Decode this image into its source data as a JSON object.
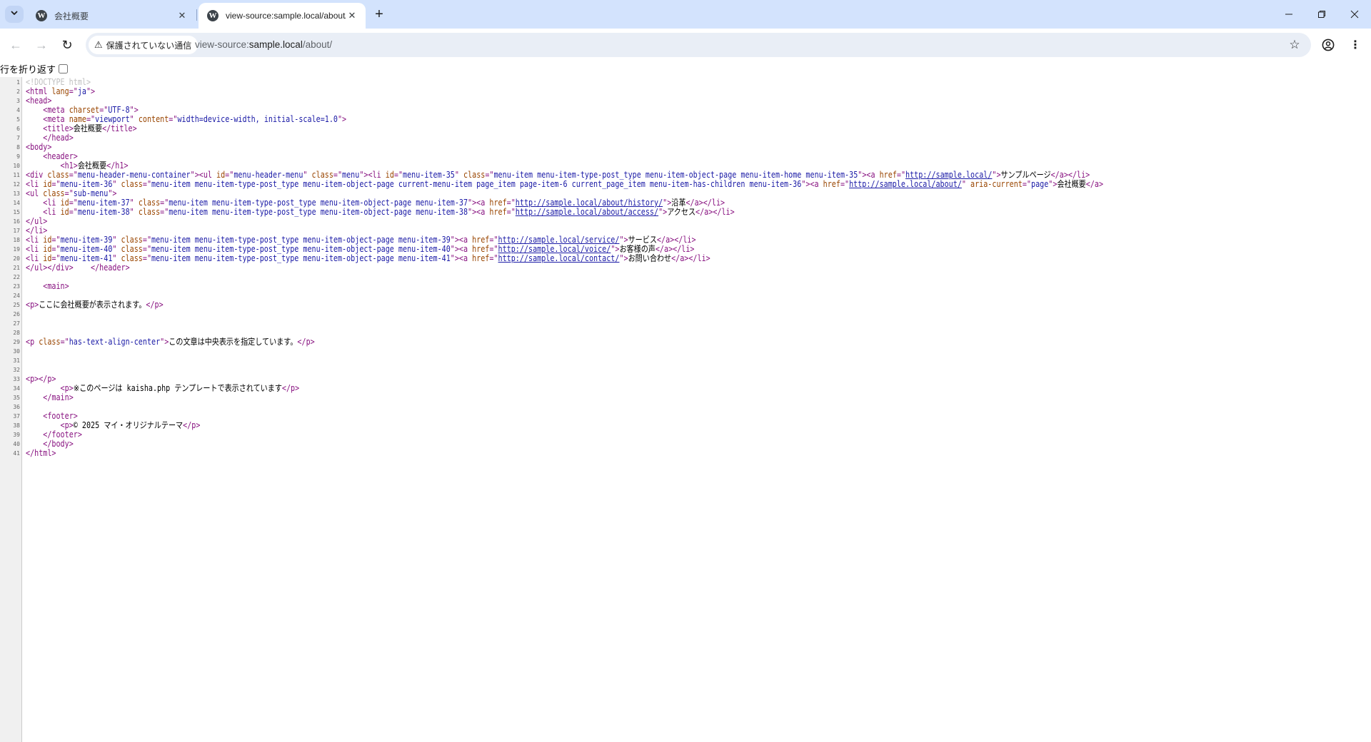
{
  "tabs": [
    {
      "title": "会社概要",
      "active": false
    },
    {
      "title": "view-source:sample.local/about/",
      "active": true
    }
  ],
  "icons": {
    "tab_search": "chevron-down-icon",
    "favicon": "wordpress-icon",
    "close": "close-icon",
    "new_tab": "plus-icon",
    "back": "arrow-left-icon",
    "forward": "arrow-right-icon",
    "reload": "reload-icon",
    "warning": "warning-icon",
    "bookmark": "star-icon",
    "profile": "profile-icon",
    "menu": "vertical-dots-icon"
  },
  "omnibox": {
    "security_label": "保護されていない通信",
    "url_scheme": "view-source:",
    "url_host": "sample.local",
    "url_path": "/about/"
  },
  "viewer": {
    "wrap_label": "行を折り返す",
    "wrap_checked": false
  },
  "source_lines": [
    [
      {
        "c": "dt",
        "t": "<!DOCTYPE html>"
      }
    ],
    [
      {
        "c": "tg",
        "t": "<html "
      },
      {
        "c": "an",
        "t": "lang"
      },
      {
        "c": "tg",
        "t": "=\""
      },
      {
        "c": "av",
        "t": "ja"
      },
      {
        "c": "tg",
        "t": "\">"
      }
    ],
    [
      {
        "c": "tg",
        "t": "<head>"
      }
    ],
    [
      {
        "c": "",
        "t": "    "
      },
      {
        "c": "tg",
        "t": "<meta "
      },
      {
        "c": "an",
        "t": "charset"
      },
      {
        "c": "tg",
        "t": "=\""
      },
      {
        "c": "av",
        "t": "UTF-8"
      },
      {
        "c": "tg",
        "t": "\">"
      }
    ],
    [
      {
        "c": "",
        "t": "    "
      },
      {
        "c": "tg",
        "t": "<meta "
      },
      {
        "c": "an",
        "t": "name"
      },
      {
        "c": "tg",
        "t": "=\""
      },
      {
        "c": "av",
        "t": "viewport"
      },
      {
        "c": "tg",
        "t": "\" "
      },
      {
        "c": "an",
        "t": "content"
      },
      {
        "c": "tg",
        "t": "=\""
      },
      {
        "c": "av",
        "t": "width=device-width, initial-scale=1.0"
      },
      {
        "c": "tg",
        "t": "\">"
      }
    ],
    [
      {
        "c": "",
        "t": "    "
      },
      {
        "c": "tg",
        "t": "<title>"
      },
      {
        "c": "",
        "t": "会社概要"
      },
      {
        "c": "tg",
        "t": "</title>"
      }
    ],
    [
      {
        "c": "",
        "t": "    "
      },
      {
        "c": "tg",
        "t": "</head>"
      }
    ],
    [
      {
        "c": "tg",
        "t": "<body>"
      }
    ],
    [
      {
        "c": "",
        "t": "    "
      },
      {
        "c": "tg",
        "t": "<header>"
      }
    ],
    [
      {
        "c": "",
        "t": "        "
      },
      {
        "c": "tg",
        "t": "<h1>"
      },
      {
        "c": "",
        "t": "会社概要"
      },
      {
        "c": "tg",
        "t": "</h1>"
      }
    ],
    [
      {
        "c": "tg",
        "t": "<div "
      },
      {
        "c": "an",
        "t": "class"
      },
      {
        "c": "tg",
        "t": "=\""
      },
      {
        "c": "av",
        "t": "menu-header-menu-container"
      },
      {
        "c": "tg",
        "t": "\"><ul "
      },
      {
        "c": "an",
        "t": "id"
      },
      {
        "c": "tg",
        "t": "=\""
      },
      {
        "c": "av",
        "t": "menu-header-menu"
      },
      {
        "c": "tg",
        "t": "\" "
      },
      {
        "c": "an",
        "t": "class"
      },
      {
        "c": "tg",
        "t": "=\""
      },
      {
        "c": "av",
        "t": "menu"
      },
      {
        "c": "tg",
        "t": "\"><li "
      },
      {
        "c": "an",
        "t": "id"
      },
      {
        "c": "tg",
        "t": "=\""
      },
      {
        "c": "av",
        "t": "menu-item-35"
      },
      {
        "c": "tg",
        "t": "\" "
      },
      {
        "c": "an",
        "t": "class"
      },
      {
        "c": "tg",
        "t": "=\""
      },
      {
        "c": "av",
        "t": "menu-item menu-item-type-post_type menu-item-object-page menu-item-home menu-item-35"
      },
      {
        "c": "tg",
        "t": "\"><a "
      },
      {
        "c": "an",
        "t": "href"
      },
      {
        "c": "tg",
        "t": "=\""
      },
      {
        "c": "lk",
        "t": "http://sample.local/"
      },
      {
        "c": "tg",
        "t": "\">"
      },
      {
        "c": "",
        "t": "サンプルページ"
      },
      {
        "c": "tg",
        "t": "</a></li>"
      }
    ],
    [
      {
        "c": "tg",
        "t": "<li "
      },
      {
        "c": "an",
        "t": "id"
      },
      {
        "c": "tg",
        "t": "=\""
      },
      {
        "c": "av",
        "t": "menu-item-36"
      },
      {
        "c": "tg",
        "t": "\" "
      },
      {
        "c": "an",
        "t": "class"
      },
      {
        "c": "tg",
        "t": "=\""
      },
      {
        "c": "av",
        "t": "menu-item menu-item-type-post_type menu-item-object-page current-menu-item page_item page-item-6 current_page_item menu-item-has-children menu-item-36"
      },
      {
        "c": "tg",
        "t": "\"><a "
      },
      {
        "c": "an",
        "t": "href"
      },
      {
        "c": "tg",
        "t": "=\""
      },
      {
        "c": "lk",
        "t": "http://sample.local/about/"
      },
      {
        "c": "tg",
        "t": "\" "
      },
      {
        "c": "an",
        "t": "aria-current"
      },
      {
        "c": "tg",
        "t": "=\""
      },
      {
        "c": "av",
        "t": "page"
      },
      {
        "c": "tg",
        "t": "\">"
      },
      {
        "c": "",
        "t": "会社概要"
      },
      {
        "c": "tg",
        "t": "</a>"
      }
    ],
    [
      {
        "c": "tg",
        "t": "<ul "
      },
      {
        "c": "an",
        "t": "class"
      },
      {
        "c": "tg",
        "t": "=\""
      },
      {
        "c": "av",
        "t": "sub-menu"
      },
      {
        "c": "tg",
        "t": "\">"
      }
    ],
    [
      {
        "c": "",
        "t": "    "
      },
      {
        "c": "tg",
        "t": "<li "
      },
      {
        "c": "an",
        "t": "id"
      },
      {
        "c": "tg",
        "t": "=\""
      },
      {
        "c": "av",
        "t": "menu-item-37"
      },
      {
        "c": "tg",
        "t": "\" "
      },
      {
        "c": "an",
        "t": "class"
      },
      {
        "c": "tg",
        "t": "=\""
      },
      {
        "c": "av",
        "t": "menu-item menu-item-type-post_type menu-item-object-page menu-item-37"
      },
      {
        "c": "tg",
        "t": "\"><a "
      },
      {
        "c": "an",
        "t": "href"
      },
      {
        "c": "tg",
        "t": "=\""
      },
      {
        "c": "lk",
        "t": "http://sample.local/about/history/"
      },
      {
        "c": "tg",
        "t": "\">"
      },
      {
        "c": "",
        "t": "沿革"
      },
      {
        "c": "tg",
        "t": "</a></li>"
      }
    ],
    [
      {
        "c": "",
        "t": "    "
      },
      {
        "c": "tg",
        "t": "<li "
      },
      {
        "c": "an",
        "t": "id"
      },
      {
        "c": "tg",
        "t": "=\""
      },
      {
        "c": "av",
        "t": "menu-item-38"
      },
      {
        "c": "tg",
        "t": "\" "
      },
      {
        "c": "an",
        "t": "class"
      },
      {
        "c": "tg",
        "t": "=\""
      },
      {
        "c": "av",
        "t": "menu-item menu-item-type-post_type menu-item-object-page menu-item-38"
      },
      {
        "c": "tg",
        "t": "\"><a "
      },
      {
        "c": "an",
        "t": "href"
      },
      {
        "c": "tg",
        "t": "=\""
      },
      {
        "c": "lk",
        "t": "http://sample.local/about/access/"
      },
      {
        "c": "tg",
        "t": "\">"
      },
      {
        "c": "",
        "t": "アクセス"
      },
      {
        "c": "tg",
        "t": "</a></li>"
      }
    ],
    [
      {
        "c": "tg",
        "t": "</ul>"
      }
    ],
    [
      {
        "c": "tg",
        "t": "</li>"
      }
    ],
    [
      {
        "c": "tg",
        "t": "<li "
      },
      {
        "c": "an",
        "t": "id"
      },
      {
        "c": "tg",
        "t": "=\""
      },
      {
        "c": "av",
        "t": "menu-item-39"
      },
      {
        "c": "tg",
        "t": "\" "
      },
      {
        "c": "an",
        "t": "class"
      },
      {
        "c": "tg",
        "t": "=\""
      },
      {
        "c": "av",
        "t": "menu-item menu-item-type-post_type menu-item-object-page menu-item-39"
      },
      {
        "c": "tg",
        "t": "\"><a "
      },
      {
        "c": "an",
        "t": "href"
      },
      {
        "c": "tg",
        "t": "=\""
      },
      {
        "c": "lk",
        "t": "http://sample.local/service/"
      },
      {
        "c": "tg",
        "t": "\">"
      },
      {
        "c": "",
        "t": "サービス"
      },
      {
        "c": "tg",
        "t": "</a></li>"
      }
    ],
    [
      {
        "c": "tg",
        "t": "<li "
      },
      {
        "c": "an",
        "t": "id"
      },
      {
        "c": "tg",
        "t": "=\""
      },
      {
        "c": "av",
        "t": "menu-item-40"
      },
      {
        "c": "tg",
        "t": "\" "
      },
      {
        "c": "an",
        "t": "class"
      },
      {
        "c": "tg",
        "t": "=\""
      },
      {
        "c": "av",
        "t": "menu-item menu-item-type-post_type menu-item-object-page menu-item-40"
      },
      {
        "c": "tg",
        "t": "\"><a "
      },
      {
        "c": "an",
        "t": "href"
      },
      {
        "c": "tg",
        "t": "=\""
      },
      {
        "c": "lk",
        "t": "http://sample.local/voice/"
      },
      {
        "c": "tg",
        "t": "\">"
      },
      {
        "c": "",
        "t": "お客様の声"
      },
      {
        "c": "tg",
        "t": "</a></li>"
      }
    ],
    [
      {
        "c": "tg",
        "t": "<li "
      },
      {
        "c": "an",
        "t": "id"
      },
      {
        "c": "tg",
        "t": "=\""
      },
      {
        "c": "av",
        "t": "menu-item-41"
      },
      {
        "c": "tg",
        "t": "\" "
      },
      {
        "c": "an",
        "t": "class"
      },
      {
        "c": "tg",
        "t": "=\""
      },
      {
        "c": "av",
        "t": "menu-item menu-item-type-post_type menu-item-object-page menu-item-41"
      },
      {
        "c": "tg",
        "t": "\"><a "
      },
      {
        "c": "an",
        "t": "href"
      },
      {
        "c": "tg",
        "t": "=\""
      },
      {
        "c": "lk",
        "t": "http://sample.local/contact/"
      },
      {
        "c": "tg",
        "t": "\">"
      },
      {
        "c": "",
        "t": "お問い合わせ"
      },
      {
        "c": "tg",
        "t": "</a></li>"
      }
    ],
    [
      {
        "c": "tg",
        "t": "</ul></div>"
      },
      {
        "c": "",
        "t": "    "
      },
      {
        "c": "tg",
        "t": "</header>"
      }
    ],
    [],
    [
      {
        "c": "",
        "t": "    "
      },
      {
        "c": "tg",
        "t": "<main>"
      }
    ],
    [],
    [
      {
        "c": "tg",
        "t": "<p>"
      },
      {
        "c": "",
        "t": "ここに会社概要が表示されます。"
      },
      {
        "c": "tg",
        "t": "</p>"
      }
    ],
    [],
    [],
    [],
    [
      {
        "c": "tg",
        "t": "<p "
      },
      {
        "c": "an",
        "t": "class"
      },
      {
        "c": "tg",
        "t": "=\""
      },
      {
        "c": "av",
        "t": "has-text-align-center"
      },
      {
        "c": "tg",
        "t": "\">"
      },
      {
        "c": "",
        "t": "この文章は中央表示を指定しています。"
      },
      {
        "c": "tg",
        "t": "</p>"
      }
    ],
    [],
    [],
    [],
    [
      {
        "c": "tg",
        "t": "<p></p>"
      }
    ],
    [
      {
        "c": "",
        "t": "        "
      },
      {
        "c": "tg",
        "t": "<p>"
      },
      {
        "c": "",
        "t": "※このページは kaisha.php テンプレートで表示されています"
      },
      {
        "c": "tg",
        "t": "</p>"
      }
    ],
    [
      {
        "c": "",
        "t": "    "
      },
      {
        "c": "tg",
        "t": "</main>"
      }
    ],
    [],
    [
      {
        "c": "",
        "t": "    "
      },
      {
        "c": "tg",
        "t": "<footer>"
      }
    ],
    [
      {
        "c": "",
        "t": "        "
      },
      {
        "c": "tg",
        "t": "<p>"
      },
      {
        "c": "",
        "t": "© 2025 マイ・オリジナルテーマ"
      },
      {
        "c": "tg",
        "t": "</p>"
      }
    ],
    [
      {
        "c": "",
        "t": "    "
      },
      {
        "c": "tg",
        "t": "</footer>"
      }
    ],
    [
      {
        "c": "",
        "t": "    "
      },
      {
        "c": "tg",
        "t": "</body>"
      }
    ],
    [
      {
        "c": "tg",
        "t": "</html>"
      }
    ]
  ]
}
